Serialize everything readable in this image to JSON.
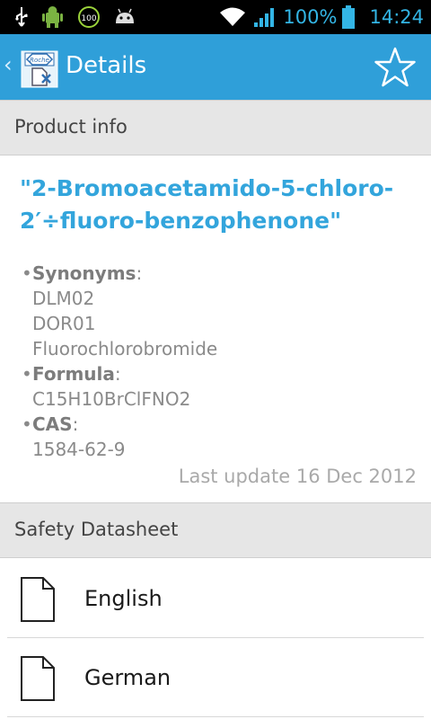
{
  "status_bar": {
    "battery_text": "100%",
    "time": "14:24",
    "accent_color": "#33b5e5",
    "left_icons": [
      "usb-icon",
      "android-debug-icon",
      "battery-100-icon",
      "android-icon"
    ],
    "right_icons": [
      "wifi-icon",
      "signal-icon",
      "battery-icon"
    ]
  },
  "action_bar": {
    "title": "Details",
    "app_icon_text": "Roche",
    "bar_color": "#2f9fd9"
  },
  "product_section": {
    "header": "Product info",
    "name": "\"2-Bromoacetamido-5-chloro-2′÷fluoro-benzophenone\"",
    "synonyms_label": "Synonyms",
    "synonyms": [
      "DLM02",
      "DOR01",
      "Fluorochlorobromide"
    ],
    "formula_label": "Formula",
    "formula": "C15H10BrClFNO2",
    "cas_label": "CAS",
    "cas": "1584-62-9",
    "last_update": "Last update 16 Dec 2012"
  },
  "safety_section": {
    "header": "Safety Datasheet",
    "languages": [
      "English",
      "German"
    ]
  }
}
